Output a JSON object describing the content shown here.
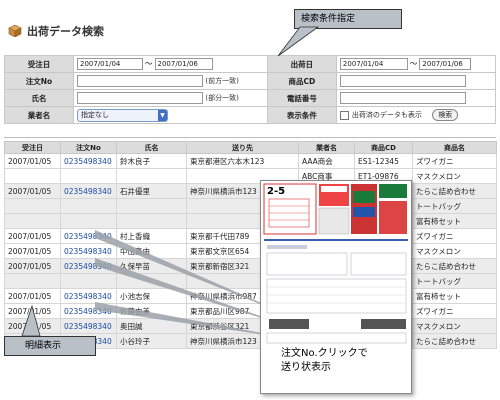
{
  "page": {
    "title": "出荷データ検索"
  },
  "callouts": {
    "search_conditions": "検索条件指定",
    "detail_display": "明細表示"
  },
  "search": {
    "ship_date_label": "受注日",
    "ship_from": "2007/01/04",
    "ship_to": "2007/01/06",
    "delivery_date_label": "出荷日",
    "delivery_from": "2007/01/04",
    "delivery_to": "2007/01/06",
    "tilde": "～",
    "order_no_label": "注文No",
    "order_no_hint": "(前方一致)",
    "product_cd_label": "商品CD",
    "name_label": "氏名",
    "name_hint": "(部分一致)",
    "phone_label": "電話番号",
    "vendor_label": "業者名",
    "vendor_selected": "指定なし",
    "display_label": "表示条件",
    "display_option": "出荷済のデータも表示",
    "search_button": "検索"
  },
  "results": {
    "headers": [
      "受注日",
      "注文No",
      "氏名",
      "送り先",
      "業者名",
      "商品CD",
      "商品名"
    ],
    "rows": [
      [
        "2007/01/05",
        "0235498340",
        "鈴木良子",
        "東京都港区六本木123",
        "AAA商会",
        "ES1-12345",
        "ズワイガニ"
      ],
      [
        "",
        "",
        "",
        "",
        "ABC商事",
        "ET1-09876",
        "マスクメロン"
      ],
      [
        "2007/01/05",
        "0235498340",
        "石井優里",
        "神奈川県横浜市123",
        "",
        "",
        "たらこ詰め合わせ"
      ],
      [
        "",
        "",
        "",
        "",
        "",
        "",
        "トートバッグ"
      ],
      [
        "",
        "",
        "",
        "",
        "",
        "",
        "富有柿セット"
      ],
      [
        "2007/01/05",
        "0235498340",
        "村上香織",
        "東京都千代田789",
        "",
        "",
        "ズワイガニ"
      ],
      [
        "2007/01/05",
        "0235498340",
        "中山真由",
        "東京都文京区654",
        "",
        "",
        "マスクメロン"
      ],
      [
        "2007/01/05",
        "0235498340",
        "久保早苗",
        "東京都新宿区321",
        "",
        "",
        "たらこ詰め合わせ"
      ],
      [
        "",
        "",
        "",
        "",
        "",
        "",
        "トートバッグ"
      ],
      [
        "2007/01/05",
        "0235498340",
        "小池志保",
        "神奈川県横浜市987",
        "",
        "",
        "富有柿セット"
      ],
      [
        "2007/01/05",
        "0235498340",
        "佐藤由美",
        "東京都品川区987",
        "",
        "",
        "ズワイガニ"
      ],
      [
        "2007/01/05",
        "0235498340",
        "奥田誠",
        "東京都渋谷区321",
        "",
        "",
        "マスクメロン"
      ],
      [
        "2007/01/05",
        "0235498340",
        "小谷玲子",
        "神奈川県横浜市123",
        "",
        "",
        "たらこ詰め合わせ"
      ]
    ]
  },
  "slip": {
    "number": "2-5",
    "caption_line1": "注文No.クリックで",
    "caption_line2": "送り状表示"
  },
  "colors": {
    "header_bg": "#dcdcdc",
    "link": "#1b4aa8",
    "callout_bg": "#b9c0c7"
  }
}
